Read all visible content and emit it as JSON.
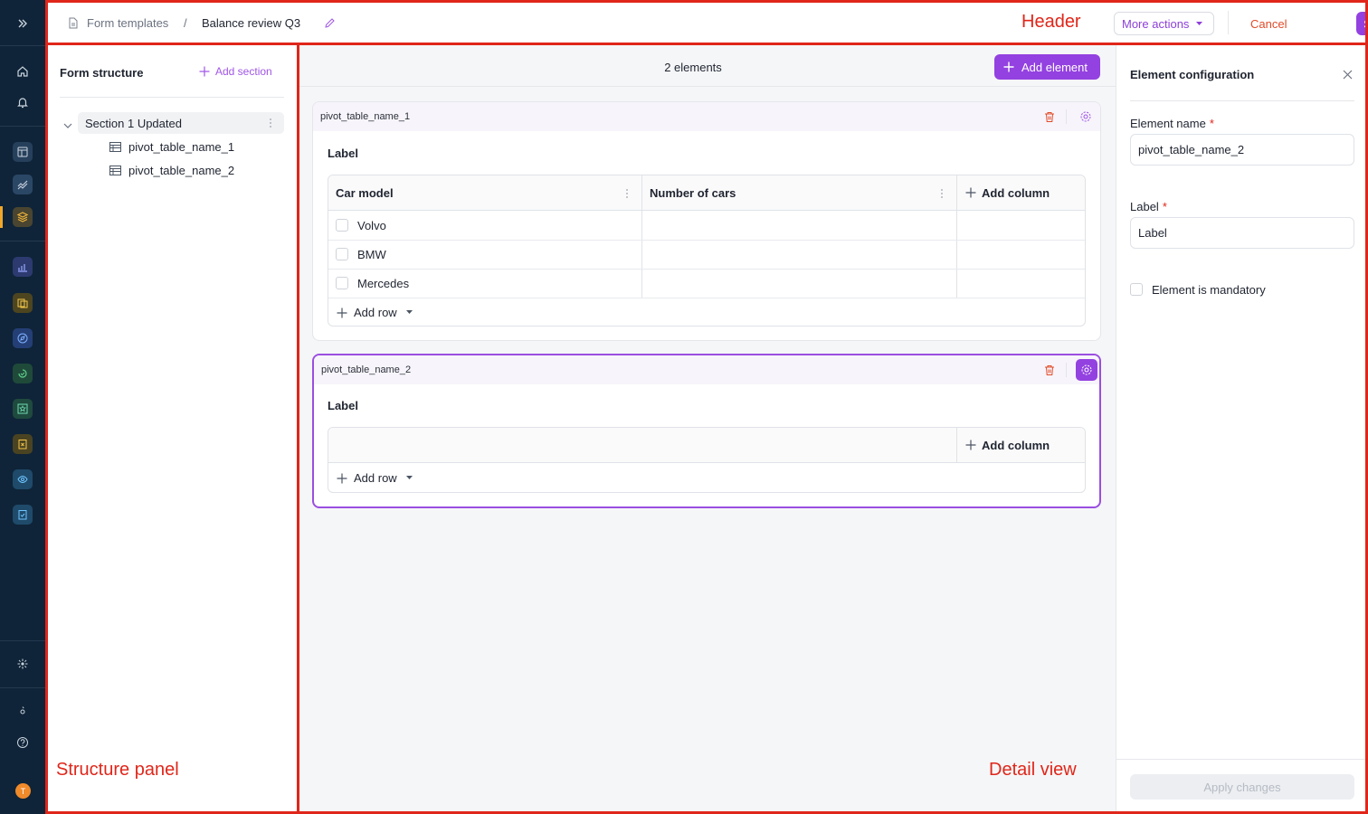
{
  "header": {
    "breadcrumb_root": "Form templates",
    "breadcrumb_separator": "/",
    "breadcrumb_current": "Balance review Q3",
    "more_actions": "More actions",
    "cancel": "Cancel",
    "save": "Save"
  },
  "annotations": {
    "header": "Header",
    "structure": "Structure panel",
    "detail": "Detail view"
  },
  "structure": {
    "title": "Form structure",
    "add_section": "Add section",
    "section_label": "Section 1 Updated",
    "items": [
      {
        "label": "pivot_table_name_1"
      },
      {
        "label": "pivot_table_name_2"
      }
    ]
  },
  "detail": {
    "count": "2 elements",
    "add_element": "Add element",
    "cards": [
      {
        "name": "pivot_table_name_1",
        "label": "Label",
        "columns": [
          "Car model",
          "Number of cars"
        ],
        "add_column": "Add column",
        "rows": [
          "Volvo",
          "BMW",
          "Mercedes"
        ],
        "add_row": "Add row"
      },
      {
        "name": "pivot_table_name_2",
        "label": "Label",
        "add_column": "Add column",
        "add_row": "Add row"
      }
    ]
  },
  "config": {
    "title": "Element configuration",
    "element_name_label": "Element name",
    "element_name_value": "pivot_table_name_2",
    "label_label": "Label",
    "label_value": "Label",
    "required_mark": "*",
    "mandatory": "Element is mandatory",
    "apply": "Apply changes"
  },
  "rail": {
    "avatar_initial": "T"
  },
  "colors": {
    "accent": "#9341e0",
    "rail": "#0f2438",
    "annotation": "#e0261a"
  }
}
